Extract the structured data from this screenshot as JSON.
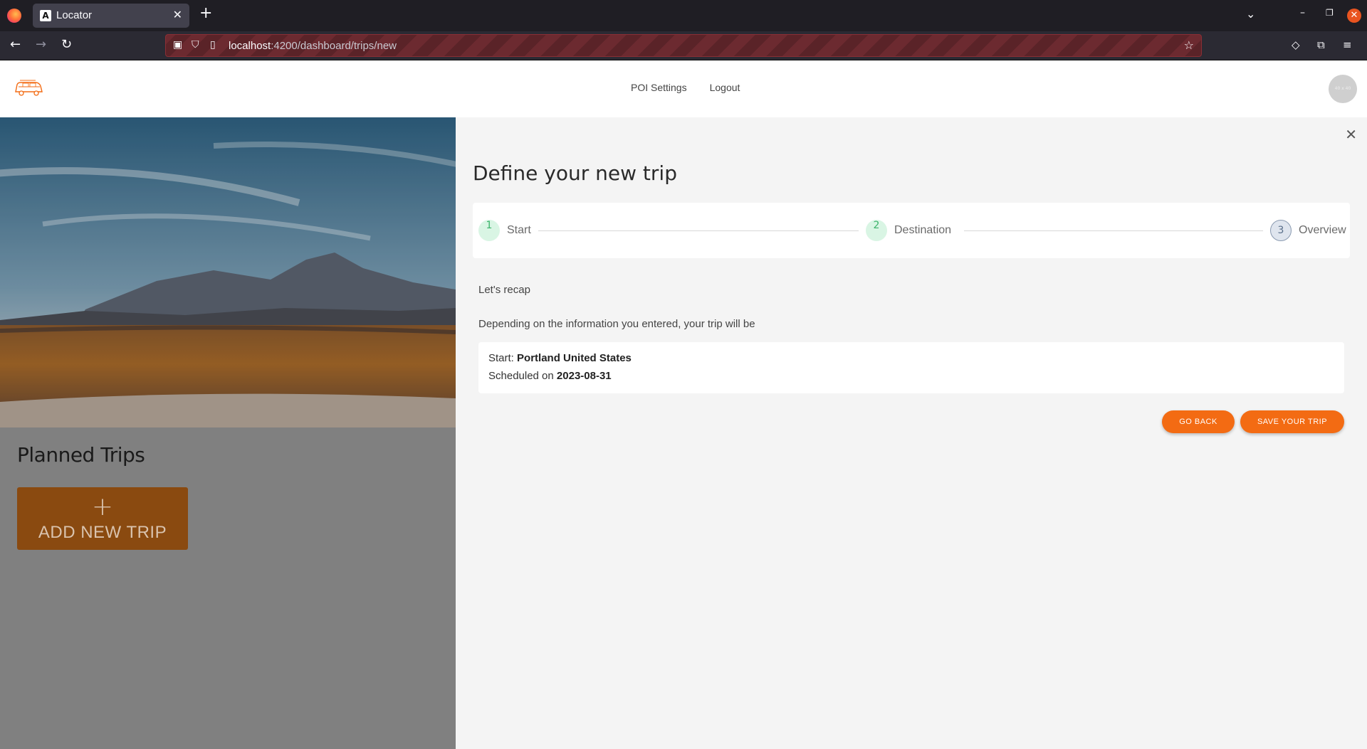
{
  "browser": {
    "tab_title": "Locator",
    "tab_favicon": "A",
    "url_host": "localhost",
    "url_path": ":4200/dashboard/trips/new"
  },
  "header": {
    "nav": [
      {
        "label": "POI Settings"
      },
      {
        "label": "Logout"
      }
    ],
    "avatar_text": "40 x 40"
  },
  "left": {
    "planned_title": "Planned Trips",
    "add_trip_plus": "+",
    "add_trip_label": "ADD NEW TRIP"
  },
  "dialog": {
    "title": "Define your new trip",
    "steps": [
      {
        "num": "1",
        "label": "Start",
        "state": "done"
      },
      {
        "num": "2",
        "label": "Destination",
        "state": "done"
      },
      {
        "num": "3",
        "label": "Overview",
        "state": "active"
      }
    ],
    "recap": "Let's recap",
    "depending": "Depending on the information you entered, your trip will be",
    "start_label": "Start:",
    "start_value": "Portland United States",
    "scheduled_label": "Scheduled on",
    "scheduled_value": "2023-08-31",
    "go_back": "GO BACK",
    "save": "SAVE YOUR TRIP"
  },
  "colors": {
    "accent": "#f36b13",
    "step_done_bg": "#d9f5e4",
    "step_done_fg": "#3bb36a"
  }
}
